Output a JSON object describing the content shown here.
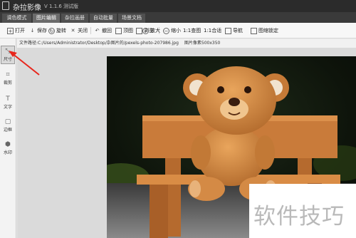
{
  "window": {
    "title": "杂拉影像",
    "version": "V 1.1.6 测试版"
  },
  "tabs": [
    {
      "label": "调色模式",
      "active": false
    },
    {
      "label": "图片编辑",
      "active": true
    },
    {
      "label": "杂拉画册",
      "active": false
    },
    {
      "label": "自动批量",
      "active": false
    },
    {
      "label": "场景文档",
      "active": false
    }
  ],
  "toolbar": {
    "open": "打开",
    "save": "保存",
    "rotate": "旋转",
    "close": "关闭",
    "undo": "撤回",
    "redo": "顶图",
    "browse": "浏览",
    "zoom_in": "放大",
    "zoom_out": "缩小",
    "ratio_1": "1:1查图",
    "ratio_fit": "1:1合适",
    "export": "导航",
    "lock": "图缩锁定"
  },
  "tools": [
    {
      "label": "尺寸",
      "icon": "resize-icon",
      "active": true
    },
    {
      "label": "裁剪",
      "icon": "crop-icon",
      "active": false
    },
    {
      "label": "文字",
      "icon": "text-icon",
      "active": false
    },
    {
      "label": "边框",
      "icon": "border-icon",
      "active": false
    },
    {
      "label": "水印",
      "icon": "watermark-icon",
      "active": false
    }
  ],
  "file_path": "文件路径:C:/Users/Administrator/Desktop/杂图片的/pexels-photo-207986.jpg",
  "image_size": "图片像素500x350",
  "watermark_text": "软件技巧",
  "colors": {
    "accent_arrow": "#e8261c",
    "titlebar": "#2b2b2b",
    "tabbar": "#3a3a3a"
  }
}
